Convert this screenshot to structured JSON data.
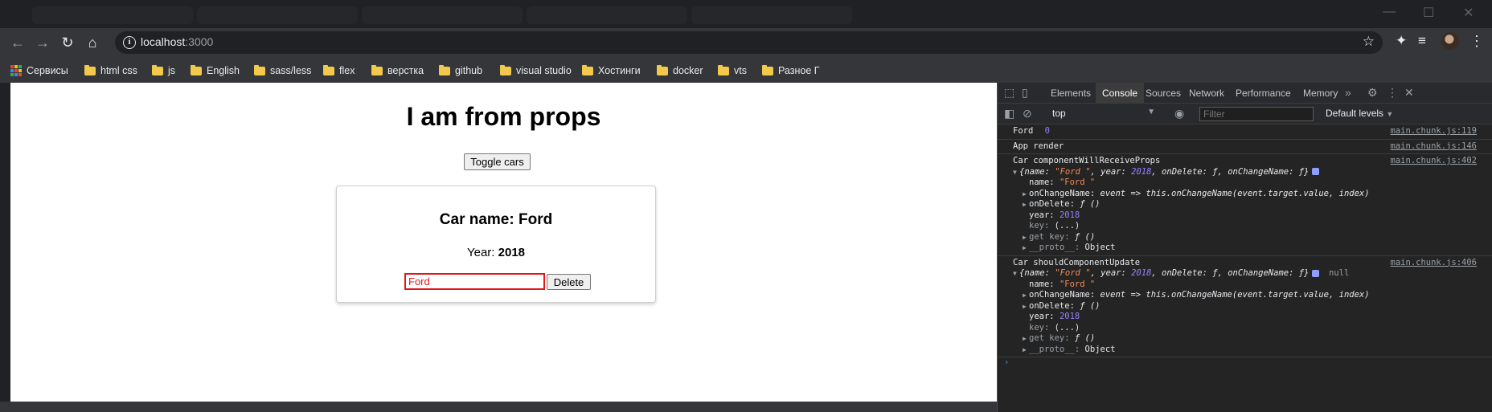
{
  "browser": {
    "url_host": "localhost",
    "url_port": ":3000",
    "bookmarks": [
      {
        "label": "Сервисы",
        "icon": "apps-grid-icon"
      },
      {
        "label": "html css",
        "icon": "folder-icon"
      },
      {
        "label": "js",
        "icon": "folder-icon"
      },
      {
        "label": "English",
        "icon": "folder-icon"
      },
      {
        "label": "sass/less",
        "icon": "folder-icon"
      },
      {
        "label": "flex",
        "icon": "folder-icon"
      },
      {
        "label": "верстка",
        "icon": "folder-icon"
      },
      {
        "label": "github",
        "icon": "folder-icon"
      },
      {
        "label": "visual studio",
        "icon": "folder-icon"
      },
      {
        "label": "Хостинги",
        "icon": "folder-icon"
      },
      {
        "label": "docker",
        "icon": "folder-icon"
      },
      {
        "label": "vts",
        "icon": "folder-icon"
      },
      {
        "label": "Разное Г",
        "icon": "folder-icon"
      }
    ]
  },
  "app": {
    "title": "I am from props",
    "toggle_label": "Toggle cars",
    "card": {
      "name_prefix": "Car name: ",
      "name": "Ford",
      "year_prefix": "Year: ",
      "year": "2018",
      "input_value": "Ford",
      "delete_label": "Delete"
    }
  },
  "devtools": {
    "tabs": [
      "Elements",
      "Console",
      "Sources",
      "Network",
      "Performance",
      "Memory"
    ],
    "active_tab": "Console",
    "context": "top",
    "filter_placeholder": "Filter",
    "levels": "Default levels",
    "messages": [
      {
        "text": "Ford",
        "value": "0",
        "source": "main.chunk.js:119"
      },
      {
        "text": "App render",
        "source": "main.chunk.js:146"
      },
      {
        "text": "Car componentWillReceiveProps",
        "source": "main.chunk.js:402"
      },
      {
        "text": "Car  shouldComponentUpdate",
        "source": "main.chunk.js:406",
        "extra": "null"
      }
    ],
    "object": {
      "name_value": "\"Ford \"",
      "year_value": "2018",
      "on_change": "event => this.onChangeName(event.target.value, index)",
      "on_delete": "ƒ ()",
      "key": "(...)",
      "get_key": "ƒ ()",
      "proto": "Object"
    }
  },
  "colors": {
    "page_bg": "#ffffff",
    "input_border": "#e0171b",
    "console_string": "#f28b54",
    "console_number": "#9980ff"
  }
}
